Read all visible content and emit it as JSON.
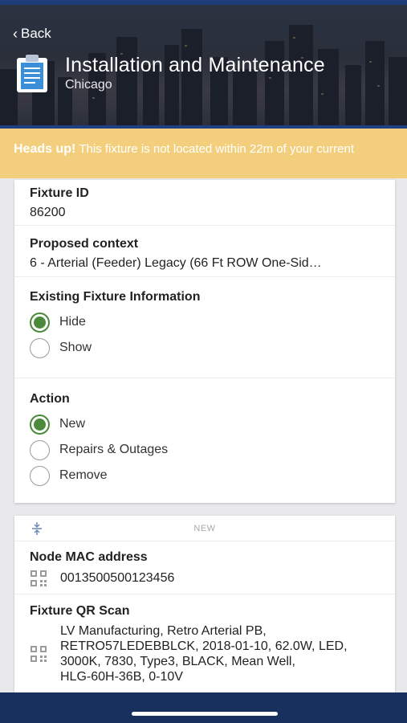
{
  "header": {
    "back_label": "Back",
    "title": "Installation and Maintenance",
    "subtitle": "Chicago"
  },
  "banner": {
    "heading": "Heads up!",
    "message": "This fixture is not located within 22m of your current"
  },
  "fixture": {
    "id_label": "Fixture ID",
    "id_value": "86200",
    "context_label": "Proposed context",
    "context_value": "6 - Arterial (Feeder) Legacy (66 Ft ROW One-Sid…"
  },
  "existing_info": {
    "label": "Existing Fixture Information",
    "options": [
      "Hide",
      "Show"
    ],
    "selected": "Hide"
  },
  "action": {
    "label": "Action",
    "options": [
      "New",
      "Repairs & Outages",
      "Remove"
    ],
    "selected": "New"
  },
  "new_section": {
    "tag": "NEW",
    "node_mac_label": "Node MAC address",
    "node_mac_value": "0013500500123456",
    "qr_label": "Fixture QR Scan",
    "qr_lines": [
      "LV Manufacturing, Retro Arterial PB,",
      "RETRO57LEDEBBLCK, 2018-01-10, 62.0W, LED,",
      "3000K, 7830, Type3, BLACK, Mean Well,",
      "HLG-60H-36B, 0-10V"
    ]
  },
  "colors": {
    "banner_bg": "#f3cf7d",
    "radio_selected": "#4a8a3a",
    "nav_bar": "#18305e"
  }
}
